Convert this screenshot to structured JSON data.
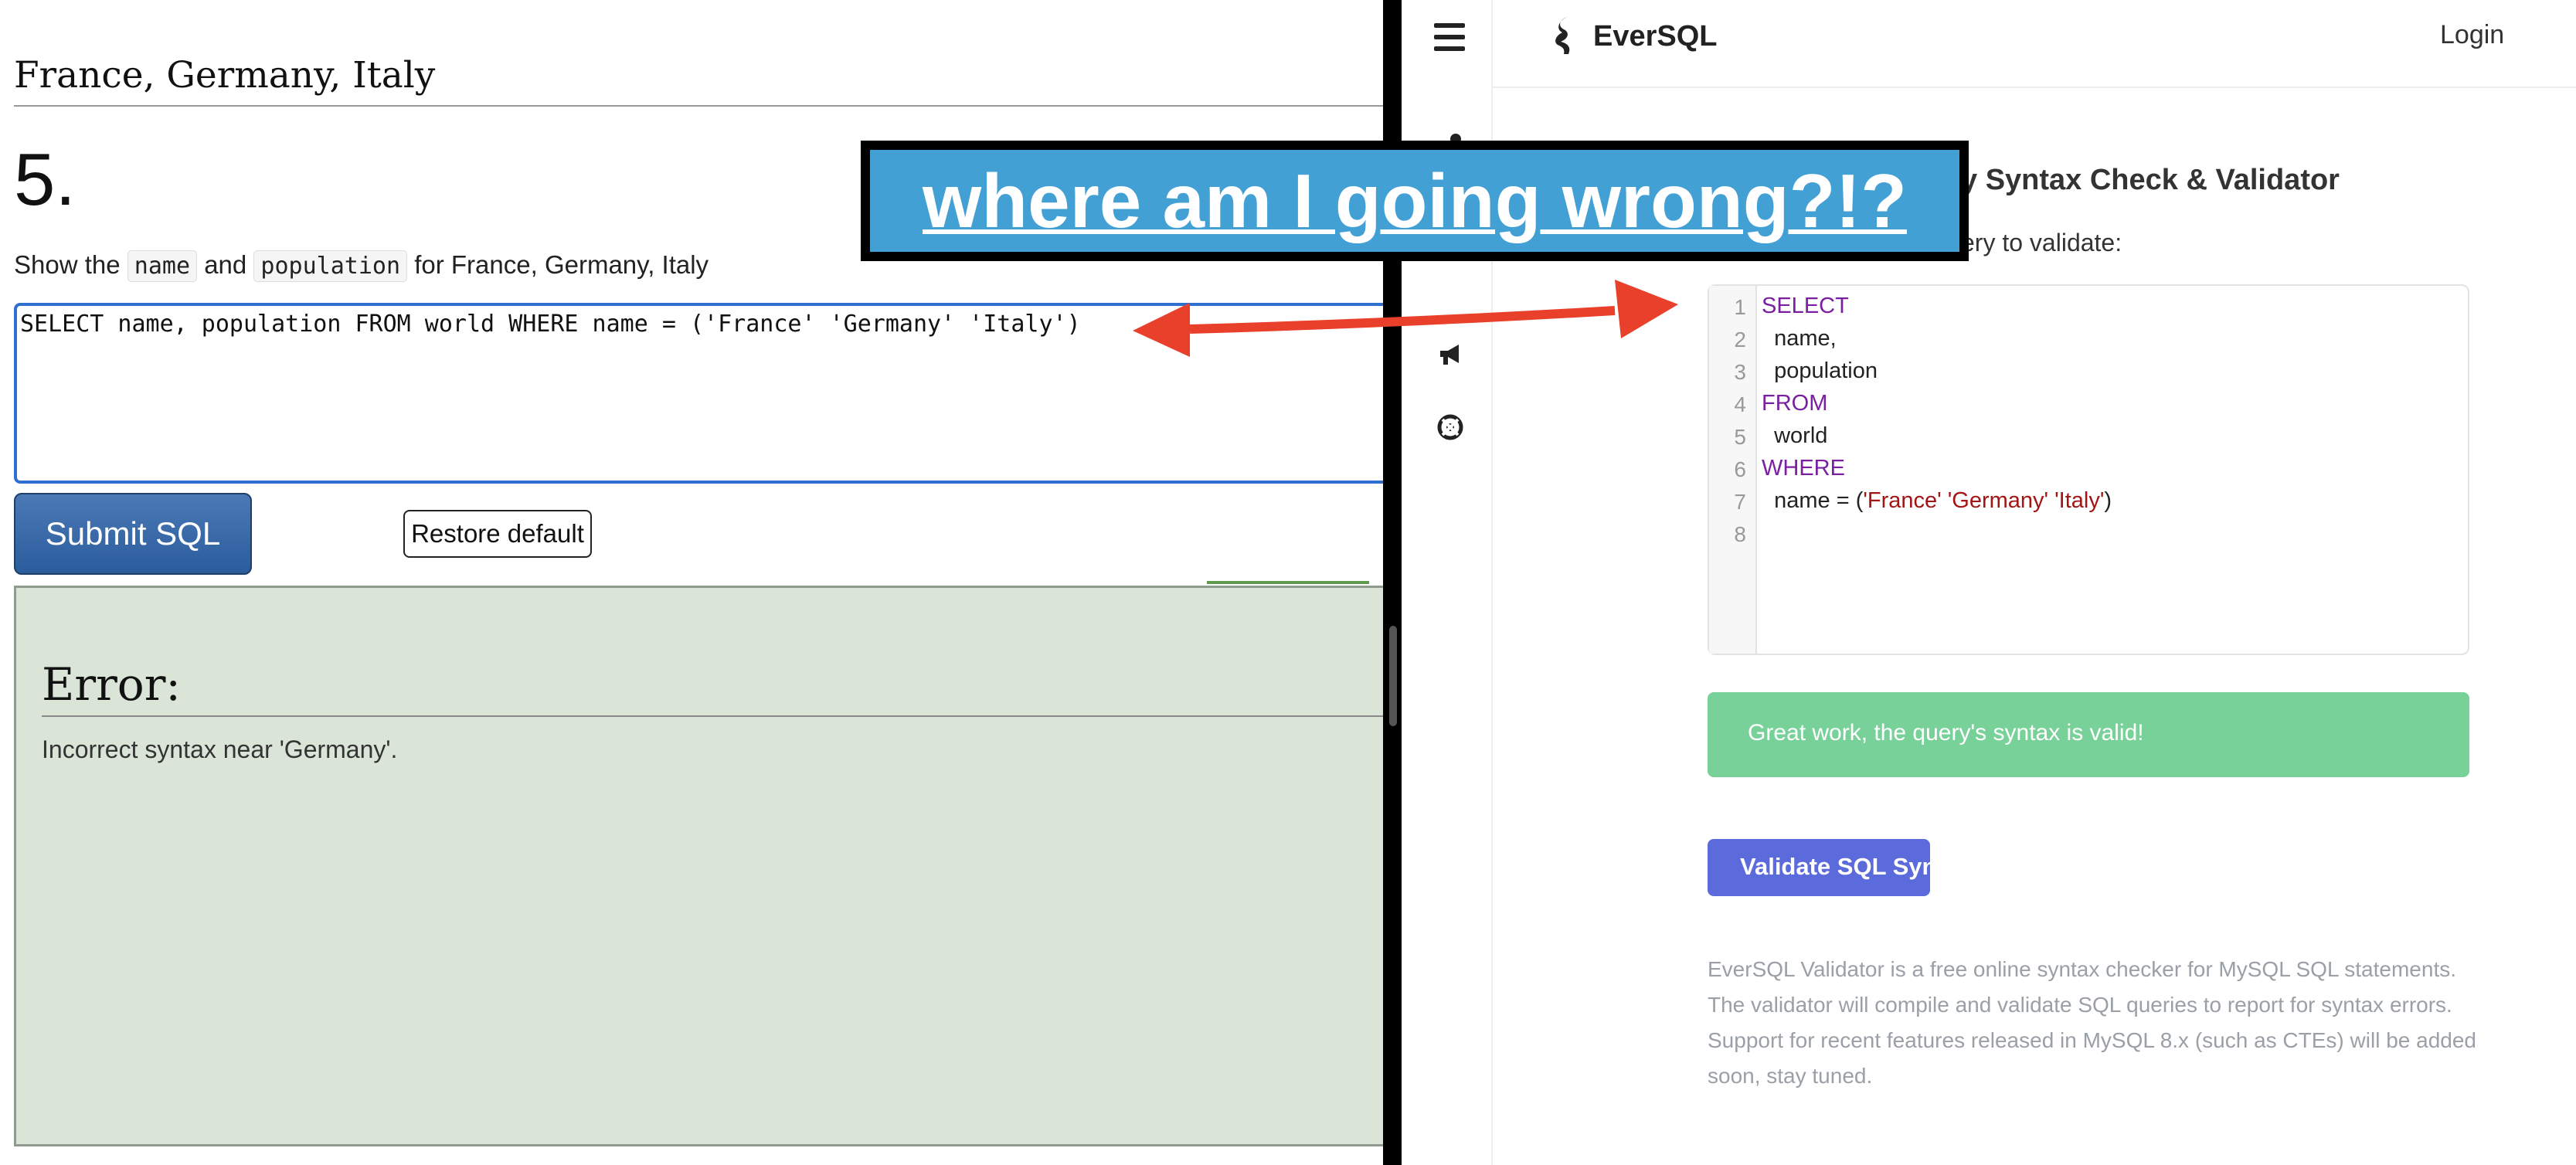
{
  "left_panel": {
    "question_heading": "France, Germany, Italy",
    "question_number": "5.",
    "instruction": {
      "prefix": "Show the",
      "field1": "name",
      "conjunction": "and",
      "field2": "population",
      "suffix": "for France, Germany, Italy"
    },
    "sql_input": "SELECT name, population FROM world WHERE name = ('France' 'Germany' 'Italy')",
    "submit_label": "Submit SQL",
    "restore_label": "Restore default",
    "error_title": "Error:",
    "error_message": "Incorrect syntax near 'Germany'."
  },
  "right_panel": {
    "brand": "EverSQL",
    "login_label": "Login",
    "page_title": "y Syntax Check & Validator",
    "query_label": "ery to validate:",
    "editor_lines": [
      {
        "num": "1",
        "text": "SELECT",
        "style": "kw"
      },
      {
        "num": "2",
        "text": "  name,",
        "style": "plain"
      },
      {
        "num": "3",
        "text": "  population",
        "style": "plain"
      },
      {
        "num": "4",
        "text": "FROM",
        "style": "kw"
      },
      {
        "num": "5",
        "text": "  world",
        "style": "plain"
      },
      {
        "num": "6",
        "text": "WHERE",
        "style": "kw"
      },
      {
        "num": "7",
        "text_prefix": "  name = (",
        "text_string": "'France' 'Germany' 'Italy'",
        "text_suffix": ")"
      },
      {
        "num": "8",
        "text": "",
        "style": "plain"
      }
    ],
    "success_message": "Great work, the query's syntax is valid!",
    "validate_label": "Validate SQL Synt",
    "description": "EverSQL Validator is a free online syntax checker for MySQL SQL statements. The validator will compile and validate SQL queries to report for syntax errors. Support for recent features released in MySQL 8.x (such as CTEs) will be added soon, stay tuned."
  },
  "overlay": {
    "caption": "where am I going wrong?!?",
    "background_color": "#42a0d4",
    "arrow_color": "#e8402a"
  },
  "colors": {
    "editor_border": "#2f6fcf",
    "submit_button": "#2b5c9c",
    "error_box": "#dae5d8",
    "success_box": "#79d19a",
    "validate_button": "#5c6bdc",
    "keyword": "#7b1fa2",
    "string": "#a31515"
  }
}
